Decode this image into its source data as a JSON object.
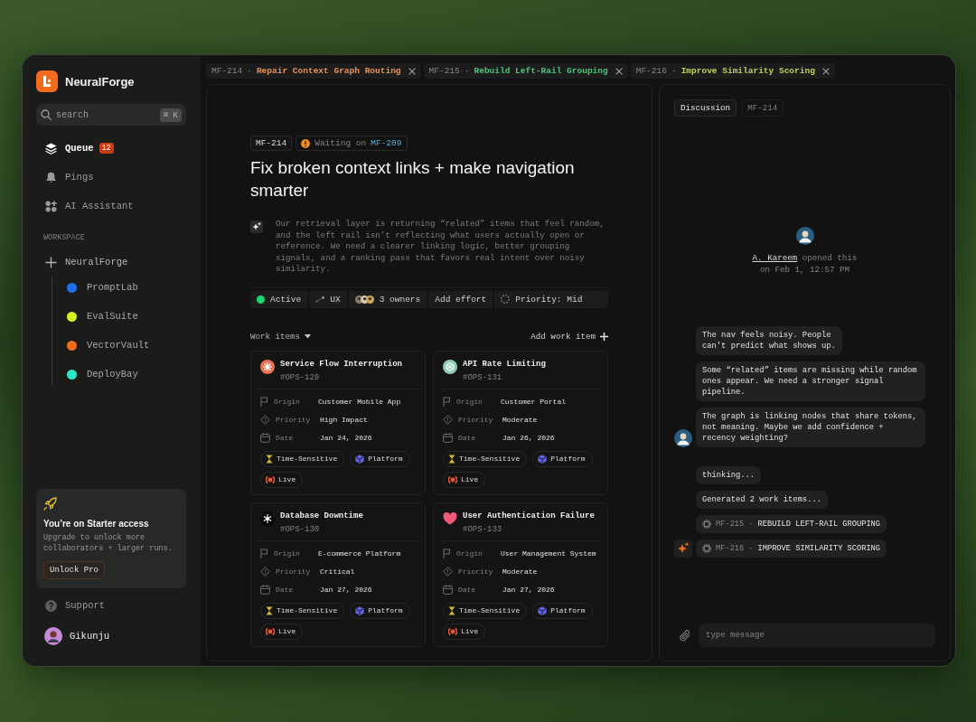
{
  "sidebar": {
    "brand": "NeuralForge",
    "search": {
      "placeholder": "search",
      "shortcut": "⌘ K"
    },
    "nav": [
      {
        "label": "Queue",
        "selected": true,
        "badge": "12"
      },
      {
        "label": "Pings",
        "selected": false
      },
      {
        "label": "AI Assistant",
        "selected": false
      }
    ],
    "section_label": "WORKSPACE",
    "workspace": {
      "label": "NeuralForge",
      "children": [
        {
          "label": "PromptLab",
          "color": "#1f6feb"
        },
        {
          "label": "EvalSuite",
          "color": "#d9f01c"
        },
        {
          "label": "VectorVault",
          "color": "#f26a1b"
        },
        {
          "label": "DeployBay",
          "color": "#2ee6c8"
        }
      ]
    },
    "upgrade": {
      "title": "You’re on Starter access",
      "text": "Upgrade to unlock more collaborators + larger runs.",
      "button": "Unlock Pro"
    },
    "support": "Support",
    "user": {
      "name": "Gikunju"
    }
  },
  "tabs": [
    {
      "id": "MF-214",
      "separator": "·",
      "title": "Repair Context Graph Routing",
      "color": "#e8935a"
    },
    {
      "id": "MF-215",
      "separator": "·",
      "title": "Rebuild Left-Rail Grouping",
      "color": "#4cc47c"
    },
    {
      "id": "MF-216",
      "separator": "·",
      "title": "Improve Similarity Scoring",
      "color": "#b8d65a"
    }
  ],
  "issue": {
    "id": "MF-214",
    "blocker": {
      "label": "Waiting on",
      "ref": "MF-209"
    },
    "title": "Fix broken context links + make navigation smarter",
    "description": "Our retrieval layer is returning “related” items that feel random, and the left rail isn’t reflecting what users actually open or reference. We need a clearer linking logic, better grouping signals, and a ranking pass that favors real intent over noisy similarity.",
    "properties": [
      {
        "kind": "status",
        "label": "Active"
      },
      {
        "kind": "tag",
        "label": "UX"
      },
      {
        "kind": "owners",
        "label": "3 owners"
      },
      {
        "kind": "action",
        "label": "Add effort"
      },
      {
        "kind": "priority",
        "label": "Priority: Mid"
      }
    ]
  },
  "work_items": {
    "title": "Work items",
    "add_label": "Add work item",
    "items": [
      {
        "title": "Service Flow Interruption",
        "id": "#OPS-129",
        "color": "#e8714f",
        "fields": [
          {
            "label": "Origin",
            "value": "Customer Mobile App"
          },
          {
            "label": "Priority",
            "value": "High Impact"
          },
          {
            "label": "Date",
            "value": "Jan 24, 2026"
          }
        ],
        "tags": [
          {
            "label": "Time-Sensitive",
            "color": "#d6b12c"
          },
          {
            "label": "Platform",
            "color": "#6060e0"
          },
          {
            "label": "Live",
            "color": "#e4572e"
          }
        ]
      },
      {
        "title": "API Rate Limiting",
        "id": "#OPS-131",
        "color": "#8ccfb2",
        "fields": [
          {
            "label": "Origin",
            "value": "Customer Portal"
          },
          {
            "label": "Priority",
            "value": "Moderate"
          },
          {
            "label": "Date",
            "value": "Jan 26, 2026"
          }
        ],
        "tags": [
          {
            "label": "Time-Sensitive",
            "color": "#d6b12c"
          },
          {
            "label": "Platform",
            "color": "#6060e0"
          },
          {
            "label": "Live",
            "color": "#e4572e"
          }
        ]
      },
      {
        "title": "Database Downtime",
        "id": "#OPS-130",
        "color": "#050505",
        "fields": [
          {
            "label": "Origin",
            "value": "E-commerce Platform"
          },
          {
            "label": "Priority",
            "value": "Critical"
          },
          {
            "label": "Date",
            "value": "Jan 27, 2026"
          }
        ],
        "tags": [
          {
            "label": "Time-Sensitive",
            "color": "#d6b12c"
          },
          {
            "label": "Platform",
            "color": "#6060e0"
          },
          {
            "label": "Live",
            "color": "#e4572e"
          }
        ]
      },
      {
        "title": "User Authentication Failure",
        "id": "#OPS-133",
        "color": "#ef5a7a",
        "fields": [
          {
            "label": "Origin",
            "value": "User Management System"
          },
          {
            "label": "Priority",
            "value": "Moderate"
          },
          {
            "label": "Date",
            "value": "Jan 27, 2026"
          }
        ],
        "tags": [
          {
            "label": "Time-Sensitive",
            "color": "#d6b12c"
          },
          {
            "label": "Platform",
            "color": "#6060e0"
          },
          {
            "label": "Live",
            "color": "#e4572e"
          }
        ]
      }
    ]
  },
  "discussion": {
    "tabs": [
      {
        "label": "Discussion",
        "selected": true
      },
      {
        "label": "MF-214",
        "selected": false
      }
    ],
    "opened": {
      "author": "A. Kareem",
      "text": "opened this on Feb 1, 12:57 PM"
    },
    "groups": [
      {
        "kind": "person",
        "messages": [
          {
            "kind": "text",
            "text": "The nav feels noisy. People\ncan't predict what shows up."
          },
          {
            "kind": "text",
            "text": "Some “related” items are missing while random ones appear. We need a stronger signal pipeline."
          },
          {
            "kind": "text",
            "text": "The graph is linking nodes that share tokens, not meaning. Maybe we add confidence + recency weighting?"
          }
        ]
      },
      {
        "kind": "assistant",
        "messages": [
          {
            "kind": "text",
            "text": "thinking..."
          },
          {
            "kind": "text",
            "text": "Generated 2 work items..."
          },
          {
            "kind": "work_item",
            "id": "MF-215",
            "separator": "·",
            "title": "REBUILD LEFT-RAIL GROUPING"
          },
          {
            "kind": "work_item",
            "id": "MF-216",
            "separator": "·",
            "title": "IMPROVE SIMILARITY SCORING"
          }
        ]
      }
    ],
    "input": {
      "placeholder": "type message"
    }
  }
}
